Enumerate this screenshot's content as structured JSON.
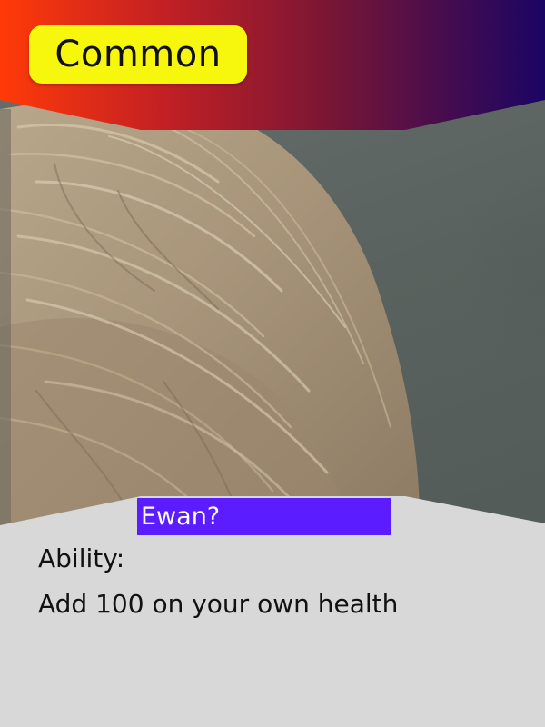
{
  "card": {
    "rarity": "Common",
    "name": "Ewan?",
    "ability_title": "Ability:",
    "ability_text": "Add 100 on your own health"
  },
  "colors": {
    "rarity_badge": "#f7f70e",
    "name_box": "#5b1cff",
    "panel": "#d8d8d8",
    "header_gradient_start": "#ff3a08",
    "header_gradient_end": "#1a0564"
  },
  "image": {
    "subject": "hair-photo"
  }
}
